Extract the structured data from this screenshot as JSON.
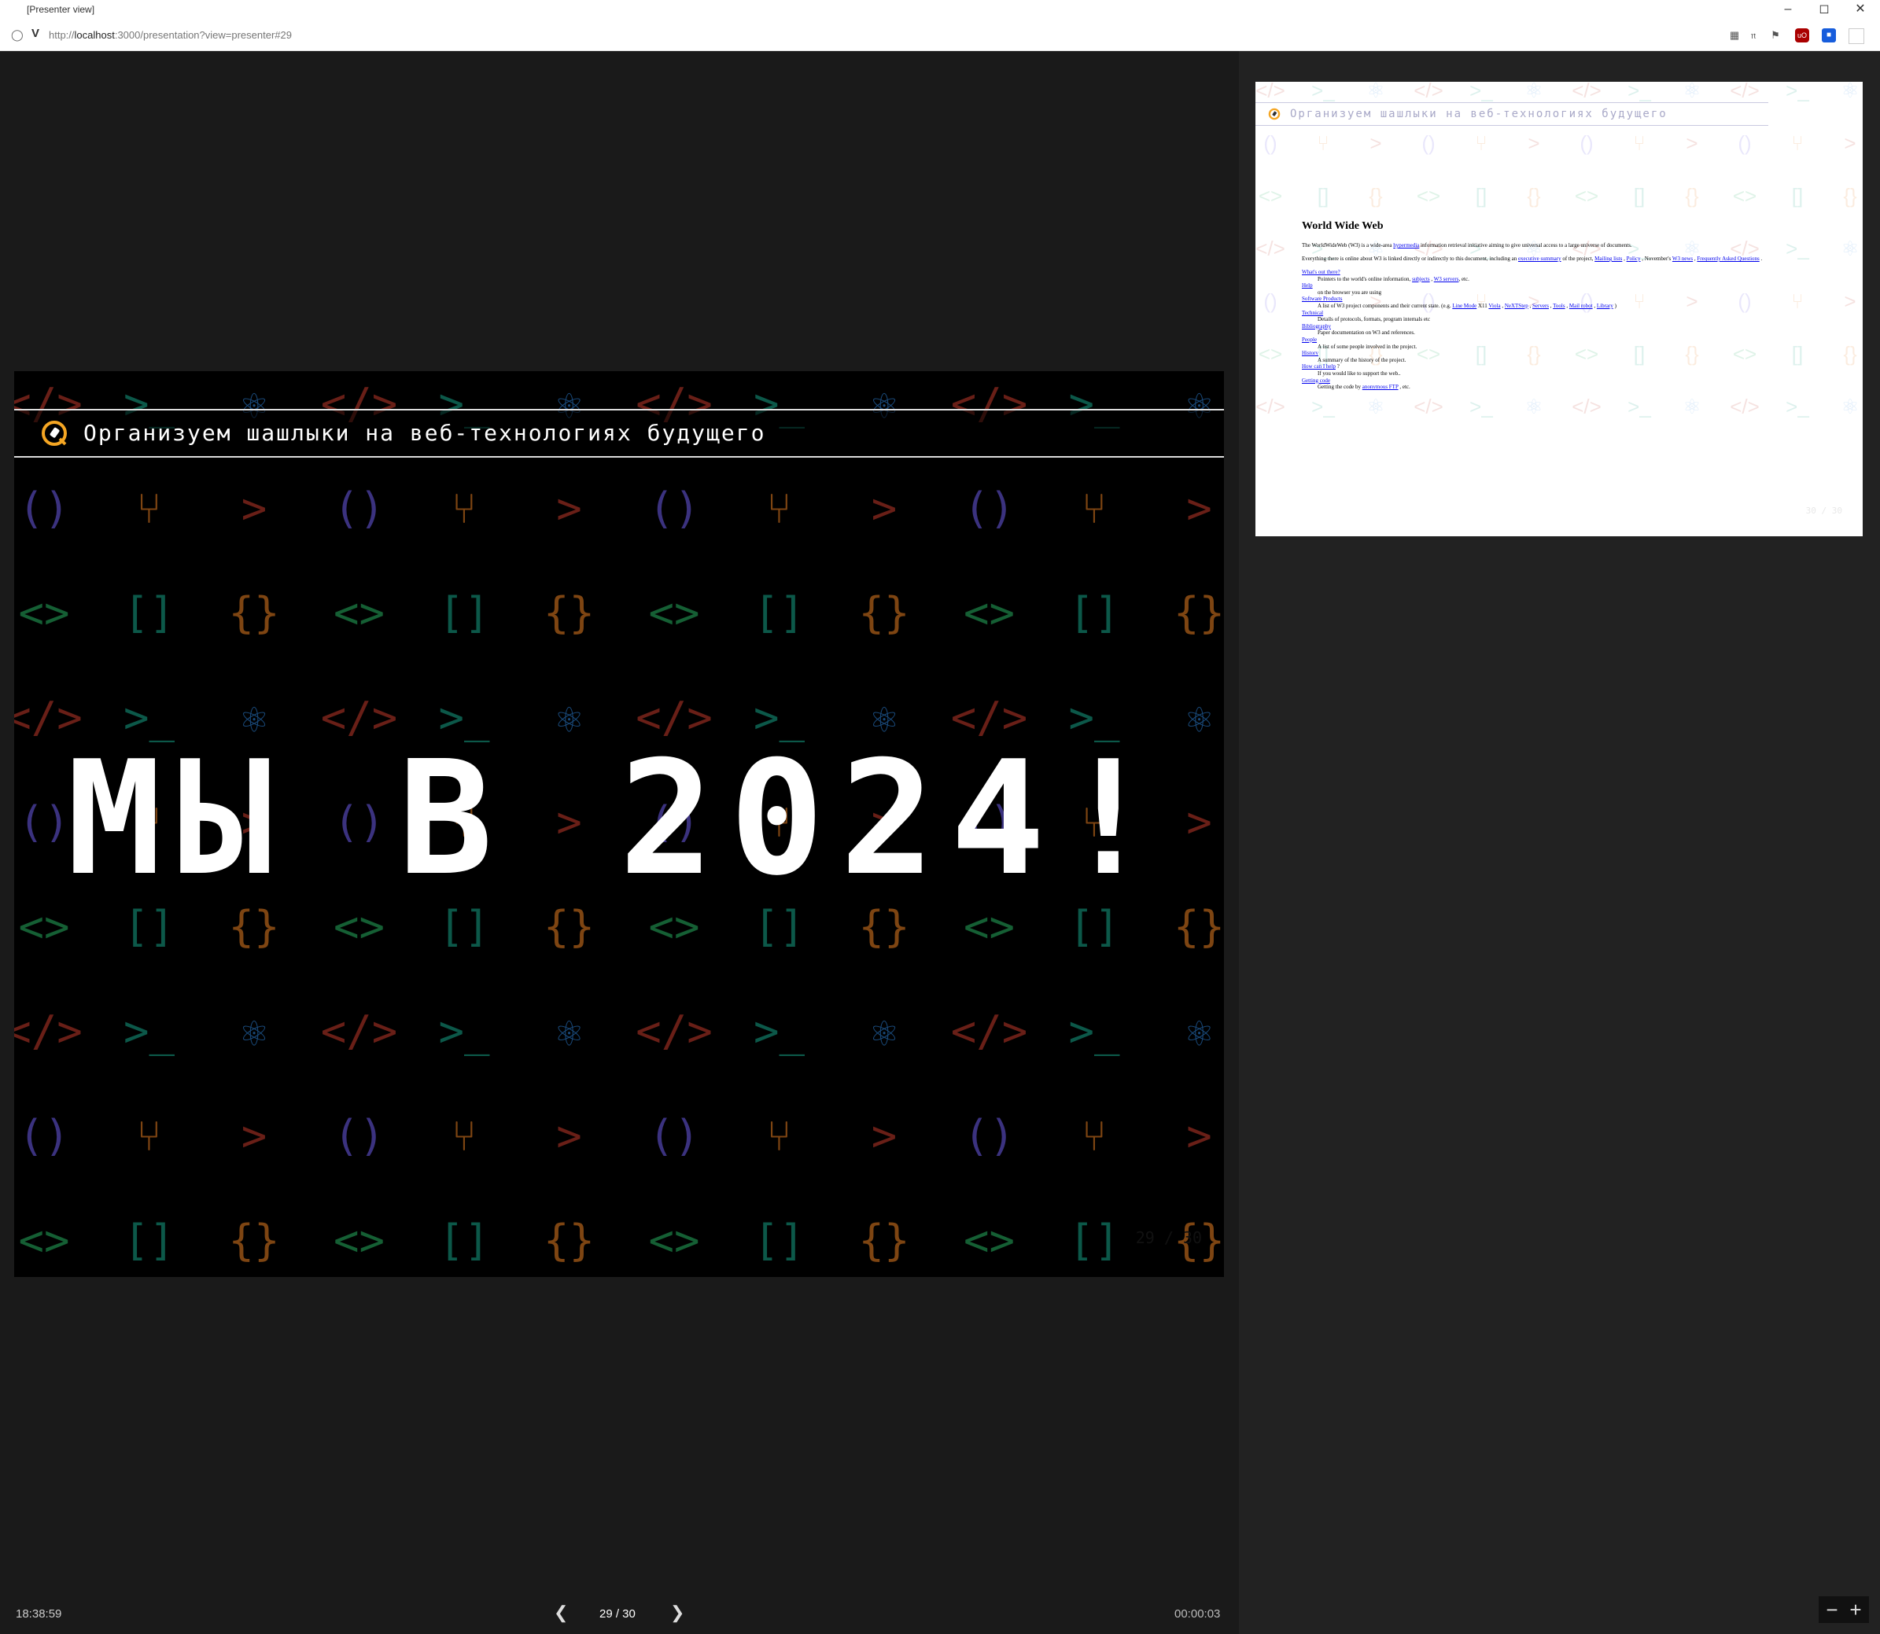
{
  "window": {
    "title": "[Presenter view]"
  },
  "browser": {
    "url_prefix": "http://",
    "url_host": "localhost",
    "url_rest": ":3000/presentation?view=presenter#29"
  },
  "slide": {
    "header": "Организуем шашлыки на веб-технологиях будущего",
    "headline": "МЫ В 2024!",
    "counter": "29 / 30"
  },
  "preview": {
    "header": "Организуем шашлыки на веб-технологиях будущего",
    "counter": "30 / 30",
    "doc": {
      "title": "World Wide Web",
      "intro_1": "The WorldWideWeb (W3) is a wide-area ",
      "intro_link": "hypermedia",
      "intro_2": " information retrieval initiative aiming to give universal access to a large universe of documents.",
      "line2_1": "Everything there is online about W3 is linked directly or indirectly to this document, including an ",
      "line2_links": [
        "executive summary",
        "Mailing lists",
        "Policy",
        "W3 news",
        "Frequently Asked Questions"
      ],
      "line2_2": " of the project, ",
      "line2_3": " , ",
      "line2_4": " , November's ",
      "line2_5": " , ",
      "line2_6": " .",
      "items": [
        {
          "term": "What's out there?",
          "desc_1": "Pointers to the world's online information, ",
          "links": [
            "subjects",
            "W3 servers"
          ],
          "desc_2": ", etc."
        },
        {
          "term": "Help",
          "desc_1": "on the browser you are using",
          "links": [],
          "desc_2": ""
        },
        {
          "term": "Software Products",
          "desc_1": "A list of W3 project components and their current state. (e.g. ",
          "links": [
            "Line Mode",
            "Viola",
            "NeXTStep",
            "Servers",
            "Tools",
            "Mail robot",
            "Library"
          ],
          "desc_2": " )"
        },
        {
          "term": "Technical",
          "desc_1": "Details of protocols, formats, program internals etc",
          "links": [],
          "desc_2": ""
        },
        {
          "term": "Bibliography",
          "desc_1": "Paper documentation on W3 and references.",
          "links": [],
          "desc_2": ""
        },
        {
          "term": "People",
          "desc_1": "A list of some people involved in the project.",
          "links": [],
          "desc_2": ""
        },
        {
          "term": "History",
          "desc_1": "A summary of the history of the project.",
          "links": [],
          "desc_2": ""
        },
        {
          "term": "How can I help",
          "desc_1": "If you would like to support the web..",
          "links": [],
          "desc_2": ""
        },
        {
          "term": "Getting code",
          "desc_1": "Getting the code by ",
          "links": [
            "anonymous FTP"
          ],
          "desc_2": " , etc."
        }
      ],
      "howhelp_suffix": " ?",
      "x11_sep": " X11 "
    }
  },
  "footer": {
    "clock": "18:38:59",
    "slide_number": "29 / 30",
    "elapsed": "00:00:03",
    "prev_icon": "chevron-left-icon",
    "next_icon": "chevron-right-icon",
    "zoom_out_icon": "minus-icon",
    "zoom_in_icon": "plus-icon"
  },
  "colors": {
    "accent_orange": "#f5a623",
    "pattern_red": "#c0392b",
    "pattern_teal": "#16a085",
    "pattern_blue": "#2e86de",
    "pattern_purple": "#6c5ce7",
    "pattern_orange": "#e67e22",
    "pattern_green": "#27ae60"
  }
}
